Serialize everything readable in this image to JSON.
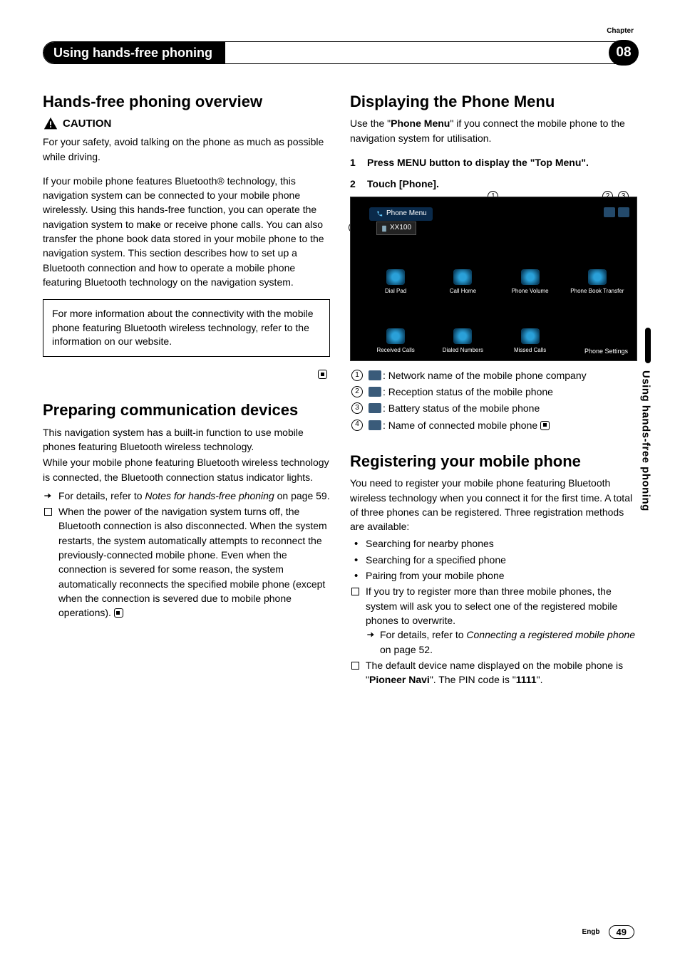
{
  "header": {
    "chapter_label": "Chapter",
    "title": "Using hands-free phoning",
    "chapter_num": "08"
  },
  "side_tab": "Using hands-free phoning",
  "footer": {
    "lang": "Engb",
    "page": "49"
  },
  "left": {
    "h_overview": "Hands-free phoning overview",
    "caution": "CAUTION",
    "caution_body": "For your safety, avoid talking on the phone as much as possible while driving.",
    "bt_para": "If your mobile phone features Bluetooth® technology, this navigation system can be connected to your mobile phone wirelessly. Using this hands-free function, you can operate the navigation system to make or receive phone calls. You can also transfer the phone book data stored in your mobile phone to the navigation system. This section describes how to set up a Bluetooth connection and how to operate a mobile phone featuring Bluetooth technology on the navigation system.",
    "box": "For more information about the connectivity with the mobile phone featuring Bluetooth wireless technology, refer to the information on our website.",
    "h_prepare": "Preparing communication devices",
    "prep_p1": "This navigation system has a built-in function to use mobile phones featuring Bluetooth wireless technology.",
    "prep_p2": "While your mobile phone featuring Bluetooth wireless technology is connected, the Bluetooth connection status indicator lights.",
    "prep_li1_a": "For details, refer to ",
    "prep_li1_i": "Notes for hands-free phoning",
    "prep_li1_b": " on page 59.",
    "prep_li2": "When the power of the navigation system turns off, the Bluetooth connection is also disconnected. When the system restarts, the system automatically attempts to reconnect the previously-connected mobile phone. Even when the connection is severed for some reason, the system automatically reconnects the specified mobile phone (except when the connection is severed due to mobile phone operations)."
  },
  "right": {
    "h_display_a": "Displaying the ",
    "h_display_b": "Phone Menu",
    "disp_p1_a": "Use the \"",
    "disp_p1_bold": "Phone Menu",
    "disp_p1_b": "\" if you connect the mobile phone to the navigation system for utilisation.",
    "step1": "Press MENU button to display the \"Top Menu\".",
    "step2": "Touch [Phone].",
    "shot": {
      "title": "Phone Menu",
      "device": "XX100",
      "cells": [
        "Dial Pad",
        "Call Home",
        "Phone Volume",
        "Phone Book Transfer",
        "Received Calls",
        "Dialed Numbers",
        "Missed Calls",
        ""
      ],
      "settings": "Phone Settings"
    },
    "legend": {
      "l1": ": Network name of the mobile phone company",
      "l2": ": Reception status of the mobile phone",
      "l3": ": Battery status of the mobile phone",
      "l4": ": Name of connected mobile phone"
    },
    "h_register": "Registering your mobile phone",
    "reg_p1": "You need to register your mobile phone featuring Bluetooth wireless technology when you connect it for the first time. A total of three phones can be registered. Three registration methods are available:",
    "reg_b1": "Searching for nearby phones",
    "reg_b2": "Searching for a specified phone",
    "reg_b3": "Pairing from your mobile phone",
    "reg_li1": "If you try to register more than three mobile phones, the system will ask you to select one of the registered mobile phones to overwrite.",
    "reg_li1_sub_a": "For details, refer to ",
    "reg_li1_sub_i": "Connecting a registered mobile phone",
    "reg_li1_sub_b": " on page 52.",
    "reg_li2_a": "The default device name displayed on the mobile phone is \"",
    "reg_li2_bold1": "Pioneer Navi",
    "reg_li2_b": "\". The PIN code is \"",
    "reg_li2_bold2": "1111",
    "reg_li2_c": "\"."
  }
}
